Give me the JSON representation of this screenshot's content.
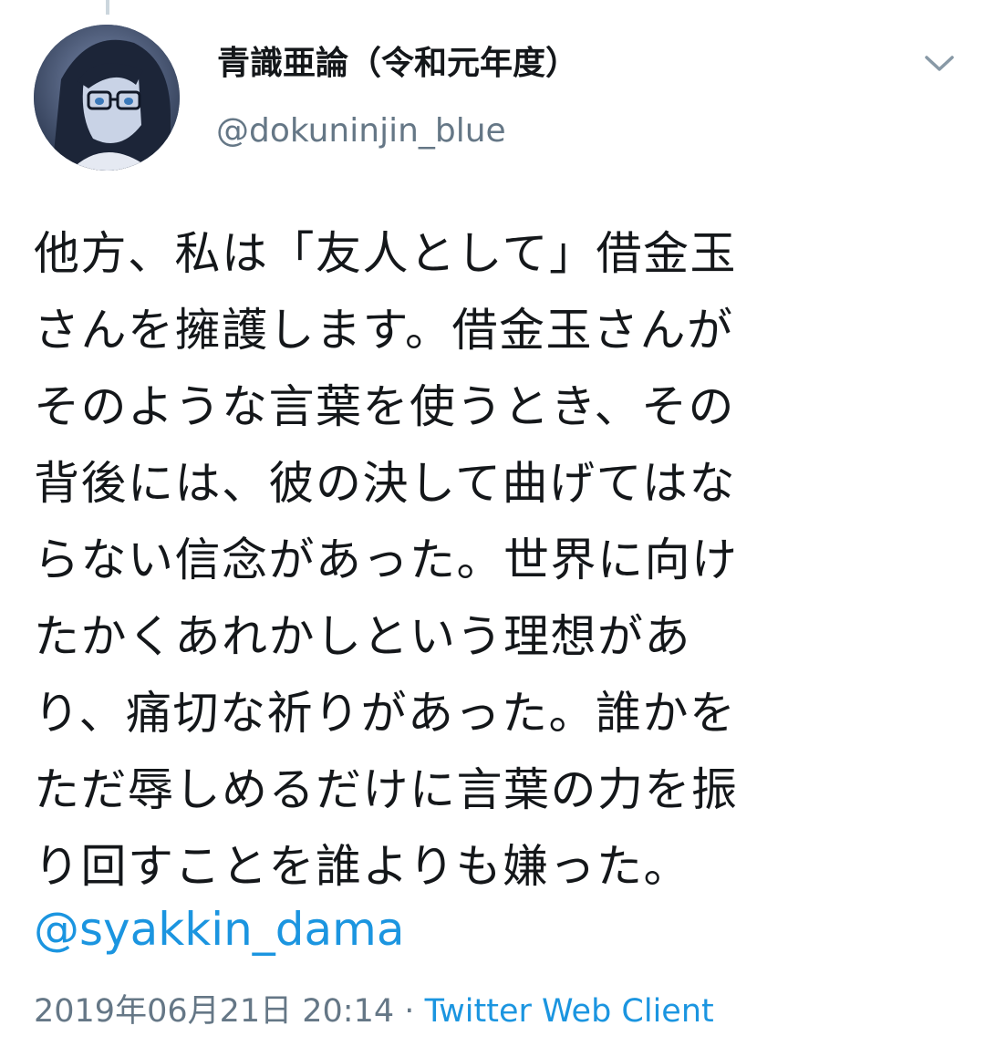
{
  "tweet": {
    "author": {
      "display_name": "青識亜論（令和元年度）",
      "handle": "@dokuninjin_blue"
    },
    "text_lines": [
      "他方、私は「友人として」借金玉",
      "さんを擁護します。借金玉さんが",
      "そのような言葉を使うとき、その",
      "背後には、彼の決して曲げてはな",
      "らない信念があった。世界に向け",
      "たかくあれかしという理想があ",
      "り、痛切な祈りがあった。誰かを",
      "ただ辱しめるだけに言葉の力を振",
      "り回すことを誰よりも嫌った。"
    ],
    "mention": "@syakkin_dama",
    "timestamp": "2019年06月21日 20:14",
    "separator": "·",
    "client": "Twitter Web Client"
  },
  "icons": {
    "menu": "chevron-down-icon",
    "avatar": "avatar-image"
  },
  "colors": {
    "text": "#14171a",
    "secondary": "#657786",
    "link": "#1b95e0",
    "thread_line": "#ccd6dd"
  }
}
